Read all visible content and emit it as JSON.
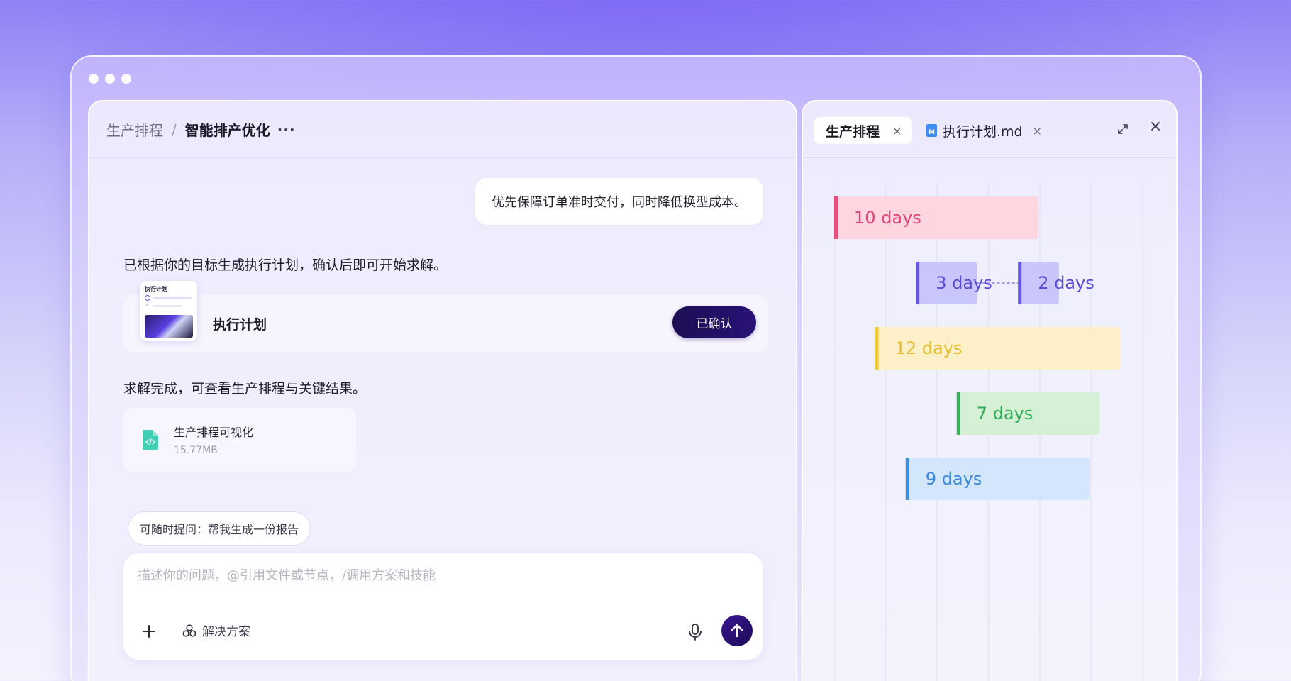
{
  "window": {
    "dots": 3
  },
  "breadcrumb": {
    "parent": "生产排程",
    "separator": "/",
    "current": "智能排产优化",
    "more": "···"
  },
  "chat": {
    "user_message": "优先保障订单准时交付，同时降低换型成本。",
    "ai_message_1": "已根据你的目标生成执行计划，确认后即可开始求解。",
    "plan_card": {
      "thumb_title": "执行计划",
      "label": "执行计划",
      "button": "已确认"
    },
    "ai_message_2": "求解完成，可查看生产排程与关键结果。",
    "file_card": {
      "name": "生产排程可视化",
      "size": "15.77MB",
      "icon": "code-file-icon"
    },
    "suggestion": "可随时提问：帮我生成一份报告"
  },
  "composer": {
    "placeholder": "描述你的问题，@引用文件或节点，/调用方案和技能",
    "add_icon": "plus-icon",
    "solution_label": "解决方案",
    "mic_icon": "microphone-icon",
    "send_icon": "arrow-up-icon"
  },
  "right_panel": {
    "tabs": [
      {
        "label": "生产排程",
        "active": true,
        "close": "×"
      },
      {
        "label": "执行计划.md",
        "active": false,
        "icon_letter": "M",
        "close": "×"
      }
    ],
    "expand_icon": "expand-icon",
    "close_icon": "close-icon"
  },
  "chart_data": {
    "type": "bar",
    "title": "",
    "xlabel": "",
    "ylabel": "",
    "tasks": [
      {
        "label": "10 days",
        "duration": 10,
        "start": 0,
        "color": "#ffd6e0",
        "accent": "#e94b7a",
        "text": "#e0457a"
      },
      {
        "label": "3 days",
        "duration": 3,
        "start": 4,
        "color": "#c9c6fb",
        "accent": "#6a55e0",
        "text": "#5a4bd6"
      },
      {
        "label": "2 days",
        "duration": 2,
        "start": 9,
        "color": "#c9c6fb",
        "accent": "#6a55e0",
        "text": "#5a4bd6",
        "depends_on": 1
      },
      {
        "label": "12 days",
        "duration": 12,
        "start": 2,
        "color": "#fdf0c8",
        "accent": "#f0c93c",
        "text": "#e5bd2e"
      },
      {
        "label": "7 days",
        "duration": 7,
        "start": 6,
        "color": "#d6f0d6",
        "accent": "#33b35a",
        "text": "#2fae58"
      },
      {
        "label": "9 days",
        "duration": 9,
        "start": 3.5,
        "color": "#d3e6fb",
        "accent": "#3c8ee0",
        "text": "#3a86d8"
      }
    ],
    "grid": true
  }
}
